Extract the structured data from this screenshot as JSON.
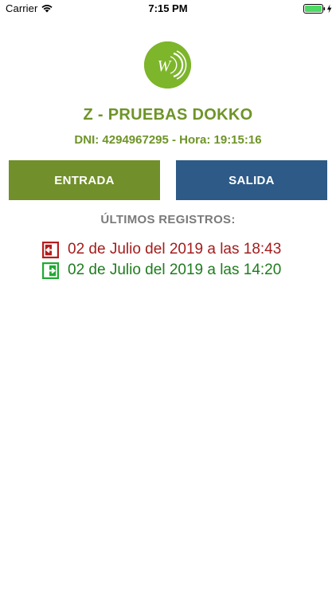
{
  "status_bar": {
    "carrier": "Carrier",
    "time": "7:15 PM",
    "wifi_icon": "wifi-icon",
    "battery_icon": "battery-charging-icon"
  },
  "logo": {
    "icon": "company-logo-icon",
    "letters": "W"
  },
  "company": {
    "name": "Z - PRUEBAS DOKKO"
  },
  "employee": {
    "info": "DNI: 4294967295 - Hora: 19:15:16"
  },
  "actions": {
    "entrada_label": "ENTRADA",
    "salida_label": "SALIDA"
  },
  "records": {
    "title": "ÚLTIMOS REGISTROS:",
    "items": [
      {
        "type": "salida",
        "icon": "exit-icon",
        "text": "02 de Julio del 2019 a las 18:43"
      },
      {
        "type": "entrada",
        "icon": "enter-icon",
        "text": "02 de Julio del 2019 a las 14:20"
      }
    ]
  },
  "colors": {
    "brand_green": "#6e9428",
    "entrada_button": "#718f2a",
    "salida_button": "#2d5a87",
    "exit_red": "#a41c1c",
    "enter_green": "#1e7c1e"
  }
}
